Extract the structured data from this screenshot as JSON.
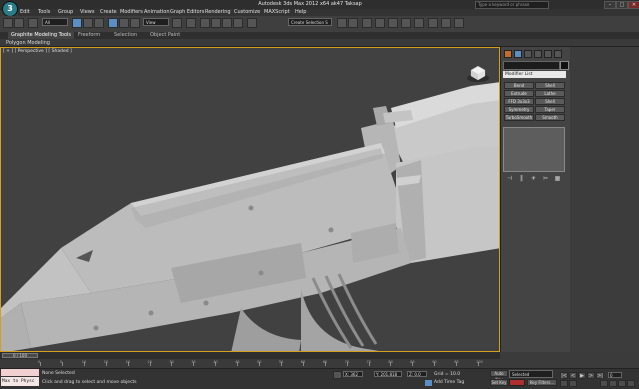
{
  "app": {
    "title": "Autodesk 3ds Max 2012 x64    ak47 Taksap",
    "logo": "3",
    "search_placeholder": "Type a keyword or phrase"
  },
  "window_buttons": [
    "–",
    "□",
    "✕"
  ],
  "menu": [
    "Edit",
    "Tools",
    "Group",
    "Views",
    "Create",
    "Modifiers",
    "Animation",
    "Graph Editors",
    "Rendering",
    "Customize",
    "MAXScript",
    "Help"
  ],
  "toolbar": {
    "selection_filter": "All",
    "ref_coord": "View",
    "named_selection": "Create Selection S"
  },
  "ribbon": {
    "tabs": [
      "Graphite Modeling Tools",
      "Freeform",
      "Selection",
      "Object Paint"
    ],
    "active_tab": "Graphite Modeling Tools",
    "subtitle": "Polygon Modeling"
  },
  "viewport": {
    "label": "[ + ] [ Perspective ] [ Shaded ]"
  },
  "command_panel": {
    "modifier_list": "Modifier List",
    "buttons": [
      [
        "Bend",
        "Shell"
      ],
      [
        "Extrude",
        "Lathe"
      ],
      [
        "FFD 3x3x3",
        "Shell"
      ],
      [
        "Symmetry",
        "Taper"
      ],
      [
        "TurboSmooth",
        "Smooth"
      ]
    ],
    "stack_icons": [
      "⊣",
      "‖",
      "☀",
      "✂",
      "▦"
    ]
  },
  "timeline": {
    "frame": "0 / 100",
    "ticks": [
      "0",
      "5",
      "10",
      "15",
      "20",
      "25",
      "30",
      "35",
      "40",
      "45",
      "50",
      "55",
      "60",
      "65",
      "70",
      "75",
      "80",
      "85",
      "90",
      "95",
      "100"
    ]
  },
  "status": {
    "maxscript_line": "Max to Physc",
    "selection": "None Selected",
    "prompt": "Click and drag to select and move objects",
    "x": "X: 362",
    "y": "Y: 201.818",
    "z": "Z: 0.0",
    "grid": "Grid = 10.0",
    "add_time_tag": "Add Time Tag",
    "auto_key": "Auto Key",
    "set_key": "Set Key",
    "selected_dropdown": "Selected",
    "key_filters": "Key Filters...",
    "frame_field": "0"
  },
  "colors": {
    "viewport_bg": "#414141",
    "active_border": "#d4a21a",
    "model": "#bdbdbd"
  }
}
